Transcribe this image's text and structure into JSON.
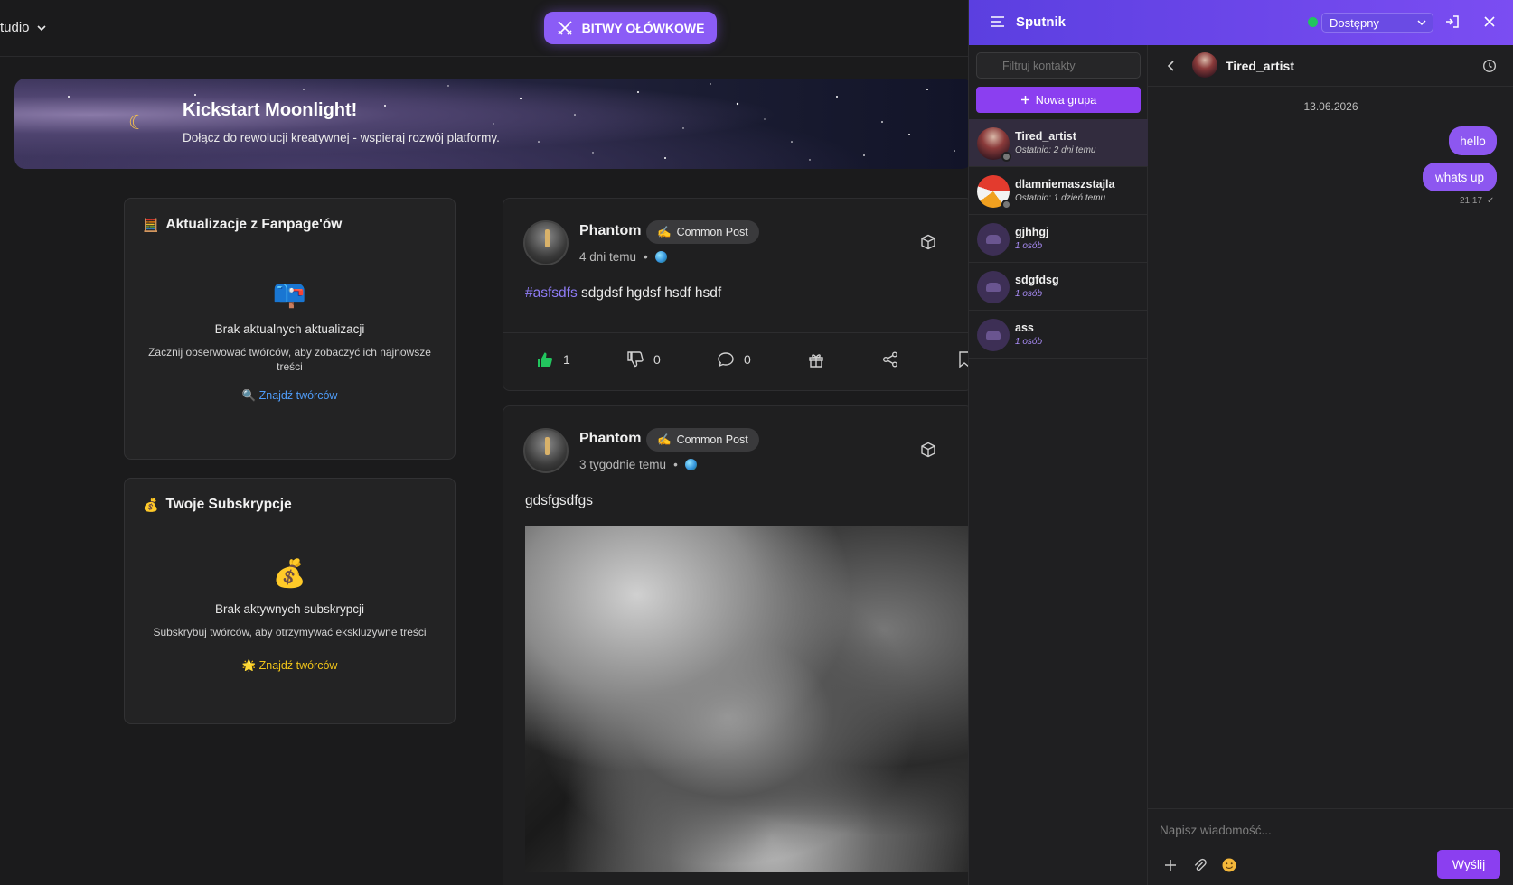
{
  "topbar": {
    "studio_label": "tudio",
    "battles_label": "BITWY OŁÓWKOWE"
  },
  "banner": {
    "title": "Kickstart Moonlight!",
    "subtitle": "Dołącz do rewolucji kreatywnej - wspieraj rozwój platformy."
  },
  "updates_card": {
    "icon": "🧮",
    "title": "Aktualizacje z Fanpage'ów",
    "empty_icon": "📪",
    "empty_title": "Brak aktualnych aktualizacji",
    "empty_desc": "Zacznij obserwować twórców, aby zobaczyć ich najnowsze treści",
    "link_icon": "🔍",
    "link_label": "Znajdź twórców"
  },
  "subs_card": {
    "icon": "💰",
    "title": "Twoje Subskrypcje",
    "empty_icon": "💰",
    "empty_title": "Brak aktywnych subskrypcji",
    "empty_desc": "Subskrybuj twórców, aby otrzymywać ekskluzywne treści",
    "link_icon": "🌟",
    "link_label": "Znajdź twórców"
  },
  "posts": [
    {
      "author": "Phantom",
      "badge_icon": "✍",
      "badge": "Common Post",
      "time": "4 dni temu",
      "dot": "•",
      "hashtag": "#asfsdfs",
      "text": "sdgdsf hgdsf hsdf hsdf",
      "likes": "1",
      "dislikes": "0",
      "comments": "0"
    },
    {
      "author": "Phantom",
      "badge_icon": "✍",
      "badge": "Common Post",
      "time": "3 tygodnie temu",
      "dot": "•",
      "text": "gdsfgsdfgs"
    }
  ],
  "chat": {
    "title": "Sputnik",
    "status": "Dostępny",
    "status_color": "#22c55e",
    "filter_placeholder": "Filtruj kontakty",
    "new_group": "Nowa grupa",
    "contacts": [
      {
        "name": "Tired_artist",
        "sub": "Ostatnio: 2 dni temu"
      },
      {
        "name": "dlamniemaszstajla",
        "sub": "Ostatnio: 1 dzień temu"
      },
      {
        "name": "gjhhgj",
        "sub": "1 osób"
      },
      {
        "name": "sdgfdsg",
        "sub": "1 osób"
      },
      {
        "name": "ass",
        "sub": "1 osób"
      }
    ],
    "conversation": {
      "name": "Tired_artist",
      "date": "13.06.2026",
      "messages": [
        "hello",
        "whats up"
      ],
      "time": "21:17",
      "read_mark": "✓",
      "input_placeholder": "Napisz wiadomość...",
      "send_label": "Wyślij"
    }
  },
  "colors": {
    "accent": "#8b5cf6",
    "chat_header": "#6a4be4",
    "bubble": "#8d57f0",
    "link_blue": "#4f9cf8",
    "link_gold": "#f0c419"
  }
}
